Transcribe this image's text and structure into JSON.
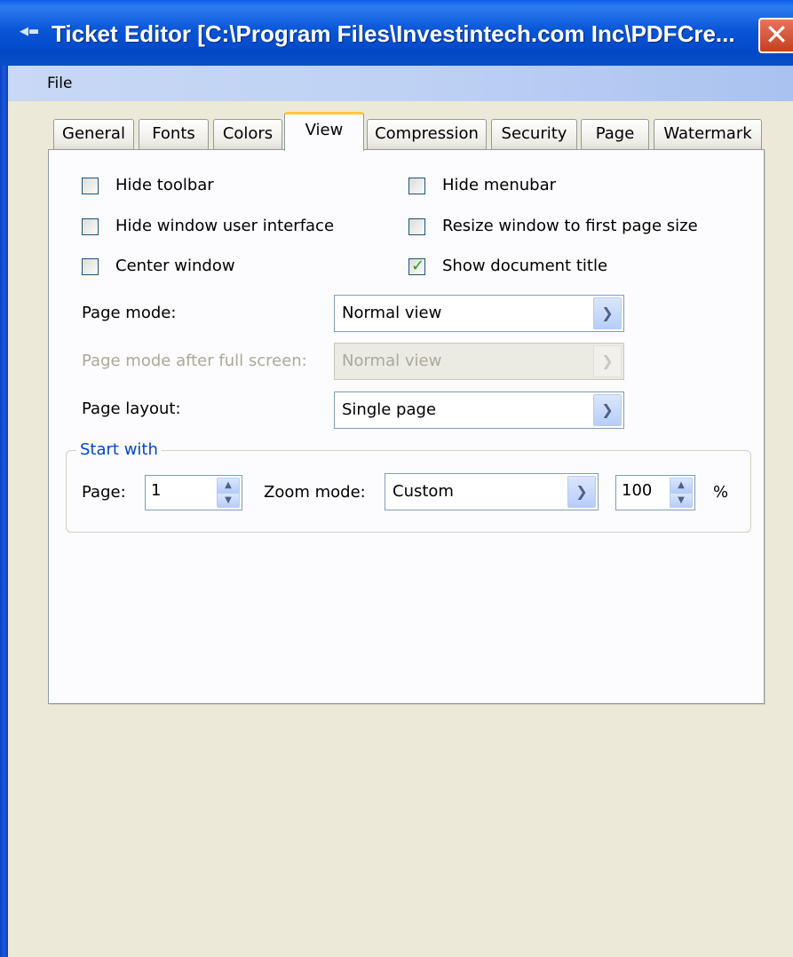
{
  "window": {
    "title": "Ticket Editor [C:\\Program Files\\Investintech.com Inc\\PDFCre...",
    "close_glyph": "✕"
  },
  "menu": {
    "file": "File"
  },
  "tabs": [
    {
      "label": "General"
    },
    {
      "label": "Fonts"
    },
    {
      "label": "Colors"
    },
    {
      "label": "View",
      "active": true
    },
    {
      "label": "Compression"
    },
    {
      "label": "Security"
    },
    {
      "label": "Page"
    },
    {
      "label": "Watermark"
    }
  ],
  "options": {
    "hide_toolbar": {
      "label": "Hide toolbar",
      "checked": false
    },
    "hide_menubar": {
      "label": "Hide menubar",
      "checked": false
    },
    "hide_window_ui": {
      "label": "Hide window user interface",
      "checked": false
    },
    "resize_window": {
      "label": "Resize window to first page size",
      "checked": false
    },
    "center_window": {
      "label": "Center window",
      "checked": false
    },
    "show_doc_title": {
      "label": "Show document title",
      "checked": true
    }
  },
  "page_mode": {
    "label": "Page mode:",
    "value": "Normal view"
  },
  "page_mode_fullscreen": {
    "label": "Page mode after full screen:",
    "value": "Normal view",
    "disabled": true
  },
  "page_layout": {
    "label": "Page layout:",
    "value": "Single page"
  },
  "start_with": {
    "legend": "Start with",
    "page_label": "Page:",
    "page_value": "1",
    "zoom_label": "Zoom mode:",
    "zoom_value": "Custom",
    "zoom_percent": "100",
    "percent_sign": "%"
  }
}
